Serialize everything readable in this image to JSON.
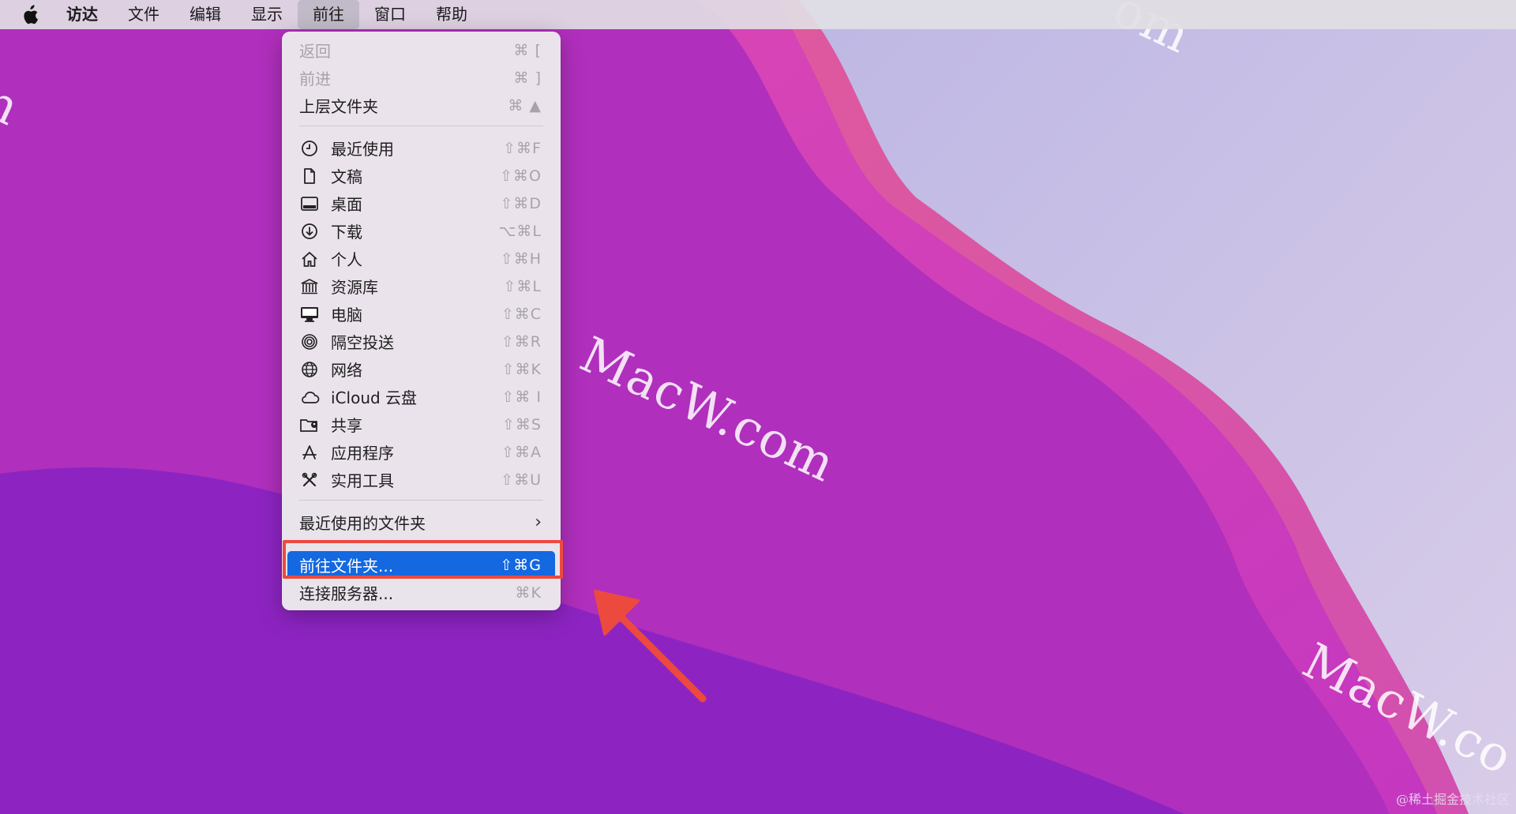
{
  "menubar": {
    "apple_icon": "apple-logo-icon",
    "items": [
      {
        "label": "访达",
        "bold": true
      },
      {
        "label": "文件"
      },
      {
        "label": "编辑"
      },
      {
        "label": "显示"
      },
      {
        "label": "前往",
        "active": true
      },
      {
        "label": "窗口"
      },
      {
        "label": "帮助"
      }
    ]
  },
  "go_menu": {
    "nav_items": [
      {
        "label": "返回",
        "shortcut": "⌘ [",
        "disabled": true
      },
      {
        "label": "前进",
        "shortcut": "⌘ ]",
        "disabled": true
      },
      {
        "label": "上层文件夹",
        "shortcut": "⌘ ▲",
        "disabled": false
      }
    ],
    "location_items": [
      {
        "label": "最近使用",
        "shortcut": "⇧⌘F",
        "icon": "clock-icon"
      },
      {
        "label": "文稿",
        "shortcut": "⇧⌘O",
        "icon": "document-icon"
      },
      {
        "label": "桌面",
        "shortcut": "⇧⌘D",
        "icon": "desktop-icon"
      },
      {
        "label": "下载",
        "shortcut": "⌥⌘L",
        "icon": "download-icon"
      },
      {
        "label": "个人",
        "shortcut": "⇧⌘H",
        "icon": "home-icon"
      },
      {
        "label": "资源库",
        "shortcut": "⇧⌘L",
        "icon": "library-icon"
      },
      {
        "label": "电脑",
        "shortcut": "⇧⌘C",
        "icon": "computer-icon"
      },
      {
        "label": "隔空投送",
        "shortcut": "⇧⌘R",
        "icon": "airdrop-icon"
      },
      {
        "label": "网络",
        "shortcut": "⇧⌘K",
        "icon": "network-icon"
      },
      {
        "label": "iCloud 云盘",
        "shortcut": "⇧⌘ I",
        "icon": "icloud-icon"
      },
      {
        "label": "共享",
        "shortcut": "⇧⌘S",
        "icon": "shared-folder-icon"
      },
      {
        "label": "应用程序",
        "shortcut": "⇧⌘A",
        "icon": "applications-icon"
      },
      {
        "label": "实用工具",
        "shortcut": "⇧⌘U",
        "icon": "utilities-icon"
      }
    ],
    "recent_folders": {
      "label": "最近使用的文件夹",
      "icon": "chevron-right-icon"
    },
    "go_to_folder": {
      "label": "前往文件夹...",
      "shortcut": "⇧⌘G"
    },
    "connect_server": {
      "label": "连接服务器...",
      "shortcut": "⌘K"
    }
  },
  "watermarks": {
    "center": "MacW.com",
    "top_left": "m",
    "top_right": "om",
    "bottom_right": "MacW.co"
  },
  "credit": "@稀土掘金技术社区",
  "colors": {
    "highlight": "#1468e0",
    "annotation": "#ec4a3f"
  }
}
